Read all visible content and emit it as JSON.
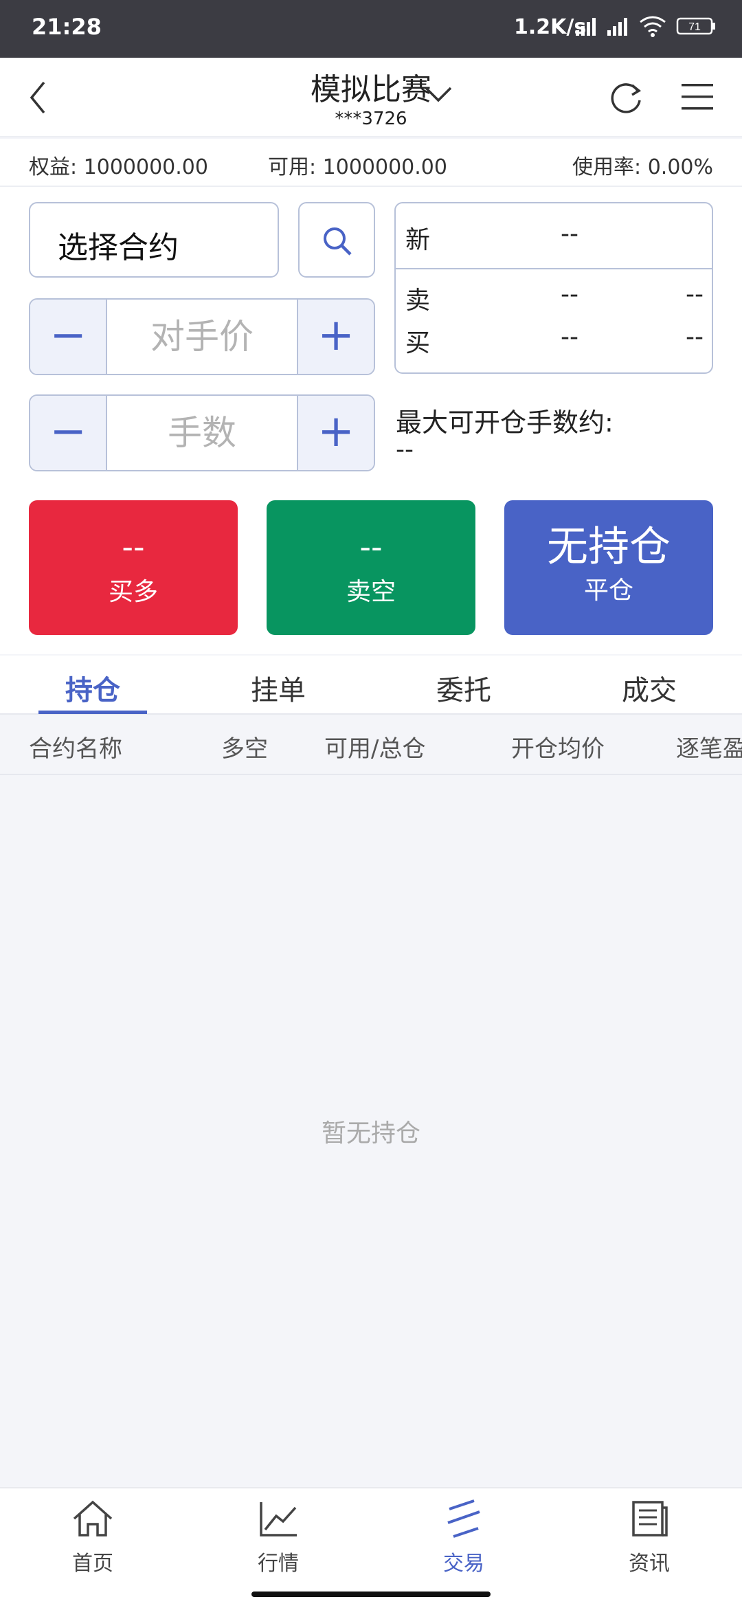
{
  "status_bar": {
    "time": "21:28",
    "speed": "1.2K/s",
    "battery": "71"
  },
  "header": {
    "title": "模拟比赛",
    "account": "***3726"
  },
  "account_summary": {
    "equity": "权益: 1000000.00",
    "available": "可用: 1000000.00",
    "usage": "使用率: 0.00%"
  },
  "order_form": {
    "contract_placeholder": "选择合约",
    "price_label": "对手价",
    "lots_label": "手数",
    "minus": "−",
    "plus": "+"
  },
  "quote": {
    "new_label": "新",
    "new_value": "--",
    "sell_label": "卖",
    "sell_price": "--",
    "sell_volume": "--",
    "buy_label": "买",
    "buy_price": "--",
    "buy_volume": "--"
  },
  "max_lots": {
    "label": "最大可开仓手数约:",
    "value": "--"
  },
  "actions": {
    "buy_long": {
      "value": "--",
      "label": "买多",
      "color": "#e8283f"
    },
    "sell_short": {
      "value": "--",
      "label": "卖空",
      "color": "#089560"
    },
    "close": {
      "value": "无持仓",
      "label": "平仓",
      "color": "#4963c6"
    }
  },
  "tabs": [
    "持仓",
    "挂单",
    "委托",
    "成交"
  ],
  "table_headers": [
    "合约名称",
    "多空",
    "可用/总仓",
    "开仓均价",
    "逐笔盈"
  ],
  "empty_text": "暂无持仓",
  "bottom_nav": [
    {
      "label": "首页",
      "icon": "home-icon"
    },
    {
      "label": "行情",
      "icon": "chart-icon"
    },
    {
      "label": "交易",
      "icon": "trade-icon"
    },
    {
      "label": "资讯",
      "icon": "news-icon"
    }
  ],
  "colors": {
    "accent": "#4963c6",
    "buy": "#e8283f",
    "sell": "#089560"
  }
}
